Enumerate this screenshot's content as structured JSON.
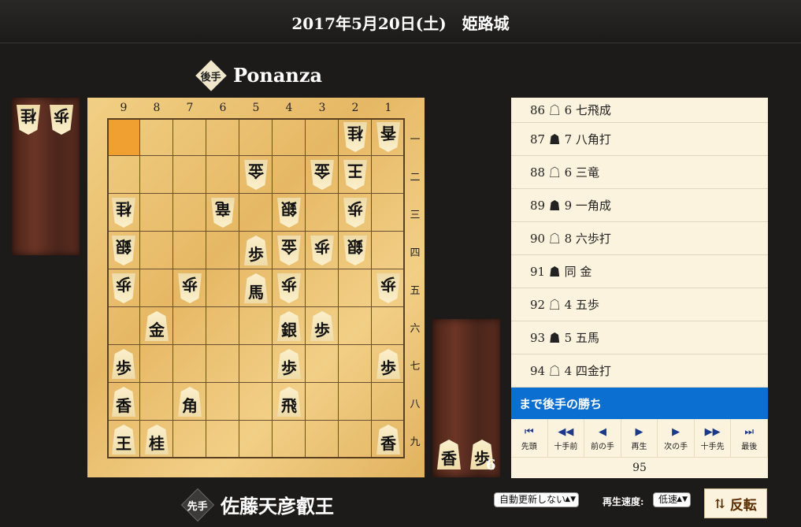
{
  "header": {
    "title": "2017年5月20日(土)　姫路城"
  },
  "gote": {
    "role": "後手",
    "name": "Ponanza",
    "hand": [
      "桂",
      "歩"
    ]
  },
  "sente": {
    "role": "先手",
    "name": "佐藤天彦叡王",
    "hand": [
      "香",
      "歩"
    ],
    "hand_count": "6"
  },
  "board": {
    "col_labels": [
      "9",
      "8",
      "7",
      "6",
      "5",
      "4",
      "3",
      "2",
      "1"
    ],
    "row_labels": [
      "一",
      "二",
      "三",
      "四",
      "五",
      "六",
      "七",
      "八",
      "九"
    ],
    "highlight": "9一",
    "pieces": [
      {
        "sq": "2一",
        "p": "桂",
        "owner": "gote"
      },
      {
        "sq": "1一",
        "p": "香",
        "owner": "gote"
      },
      {
        "sq": "5二",
        "p": "金",
        "owner": "gote"
      },
      {
        "sq": "3二",
        "p": "金",
        "owner": "gote"
      },
      {
        "sq": "2二",
        "p": "王",
        "owner": "gote"
      },
      {
        "sq": "9三",
        "p": "桂",
        "owner": "gote"
      },
      {
        "sq": "6三",
        "p": "竜",
        "owner": "gote"
      },
      {
        "sq": "4三",
        "p": "銀",
        "owner": "gote"
      },
      {
        "sq": "2三",
        "p": "歩",
        "owner": "gote"
      },
      {
        "sq": "9四",
        "p": "銀",
        "owner": "gote"
      },
      {
        "sq": "5四",
        "p": "歩",
        "owner": "sente"
      },
      {
        "sq": "4四",
        "p": "金",
        "owner": "gote"
      },
      {
        "sq": "3四",
        "p": "歩",
        "owner": "gote"
      },
      {
        "sq": "2四",
        "p": "銀",
        "owner": "gote"
      },
      {
        "sq": "9五",
        "p": "歩",
        "owner": "gote"
      },
      {
        "sq": "7五",
        "p": "歩",
        "owner": "gote"
      },
      {
        "sq": "5五",
        "p": "馬",
        "owner": "sente"
      },
      {
        "sq": "4五",
        "p": "歩",
        "owner": "gote"
      },
      {
        "sq": "1五",
        "p": "歩",
        "owner": "gote"
      },
      {
        "sq": "8六",
        "p": "金",
        "owner": "sente"
      },
      {
        "sq": "4六",
        "p": "銀",
        "owner": "sente"
      },
      {
        "sq": "3六",
        "p": "歩",
        "owner": "sente"
      },
      {
        "sq": "9七",
        "p": "歩",
        "owner": "sente"
      },
      {
        "sq": "4七",
        "p": "歩",
        "owner": "sente"
      },
      {
        "sq": "1七",
        "p": "歩",
        "owner": "sente"
      },
      {
        "sq": "9八",
        "p": "香",
        "owner": "sente"
      },
      {
        "sq": "7八",
        "p": "角",
        "owner": "sente"
      },
      {
        "sq": "4八",
        "p": "飛",
        "owner": "sente"
      },
      {
        "sq": "9九",
        "p": "王",
        "owner": "sente"
      },
      {
        "sq": "8九",
        "p": "桂",
        "owner": "sente"
      },
      {
        "sq": "1九",
        "p": "香",
        "owner": "sente"
      }
    ]
  },
  "moves": [
    {
      "num": "86",
      "mark": "☖",
      "text": "6 七飛成"
    },
    {
      "num": "87",
      "mark": "☗",
      "text": "7 八角打"
    },
    {
      "num": "88",
      "mark": "☖",
      "text": "6 三竜"
    },
    {
      "num": "89",
      "mark": "☗",
      "text": "9 一角成"
    },
    {
      "num": "90",
      "mark": "☖",
      "text": "8 六歩打"
    },
    {
      "num": "91",
      "mark": "☗",
      "text": "同 金"
    },
    {
      "num": "92",
      "mark": "☖",
      "text": "4 五歩"
    },
    {
      "num": "93",
      "mark": "☗",
      "text": "5 五馬"
    },
    {
      "num": "94",
      "mark": "☖",
      "text": "4 四金打"
    }
  ],
  "result": "まで後手の勝ち",
  "controls": [
    {
      "icon": "⏮",
      "label": "先頭"
    },
    {
      "icon": "◀◀",
      "label": "十手前"
    },
    {
      "icon": "◀",
      "label": "前の手"
    },
    {
      "icon": "▶",
      "label": "再生"
    },
    {
      "icon": "▶",
      "label": "次の手"
    },
    {
      "icon": "▶▶",
      "label": "十手先"
    },
    {
      "icon": "⏭",
      "label": "最後"
    }
  ],
  "move_number": "95",
  "auto_update": {
    "value": "自動更新しない"
  },
  "speed": {
    "label": "再生速度:",
    "value": "低速"
  },
  "flip": {
    "label": "反転"
  }
}
